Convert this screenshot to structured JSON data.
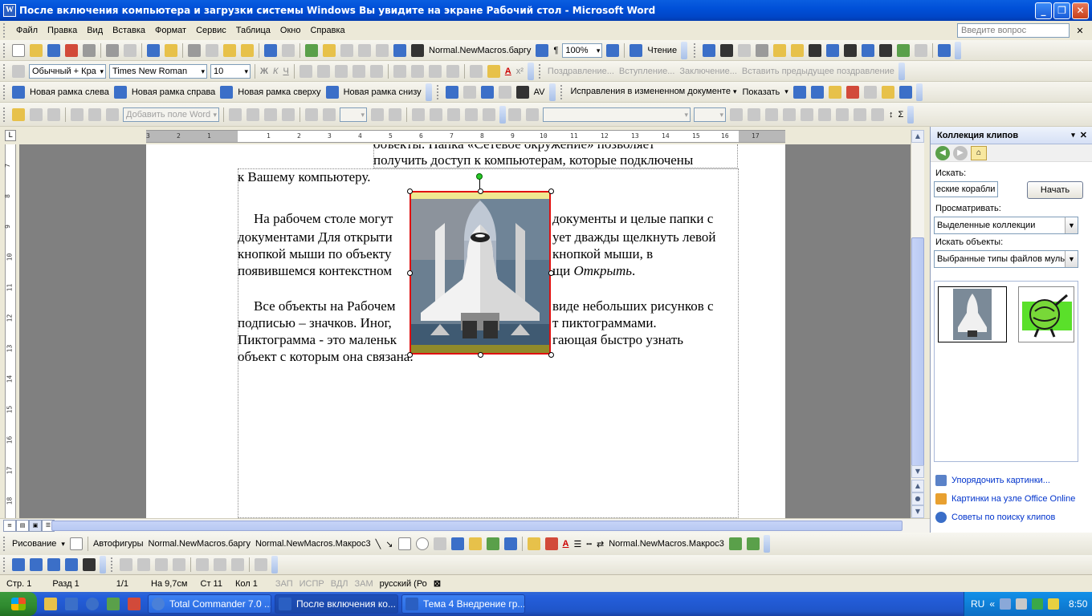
{
  "window": {
    "title": "После включения компьютера и загрузки системы Windows Вы увидите на экране Рабочий стол - Microsoft Word",
    "app_icon": "W"
  },
  "menu": {
    "items": [
      "Файл",
      "Правка",
      "Вид",
      "Вставка",
      "Формат",
      "Сервис",
      "Таблица",
      "Окно",
      "Справка"
    ],
    "help_placeholder": "Введите вопрос"
  },
  "toolbar_standard": {
    "macro_label": "Normal.NewMacros.баргу",
    "zoom": "100%",
    "reading": "Чтение"
  },
  "toolbar_formatting": {
    "style": "Обычный + Кра",
    "font": "Times New Roman",
    "size": "10",
    "mail_items": [
      "Поздравление...",
      "Вступление...",
      "Заключение...",
      "Вставить предыдущее поздравление"
    ]
  },
  "toolbar_frames": {
    "left": "Новая рамка слева",
    "right": "Новая рамка справа",
    "top": "Новая рамка сверху",
    "bottom": "Новая рамка снизу",
    "tracking": "Исправления в измененном документе",
    "show": "Показать"
  },
  "toolbar_mailmerge": {
    "add_field": "Добавить поле Word"
  },
  "ruler": {
    "marks": [
      "3",
      "2",
      "1",
      "1",
      "2",
      "3",
      "4",
      "5",
      "6",
      "7",
      "8",
      "9",
      "10",
      "11",
      "12",
      "13",
      "14",
      "15",
      "16",
      "17"
    ],
    "vmarks": [
      "7",
      "8",
      "9",
      "10",
      "11",
      "12",
      "13",
      "14",
      "15",
      "16",
      "17",
      "18"
    ]
  },
  "document": {
    "top_lines": [
      "объекты. Папка «Сетевое окружение» позволяет",
      "получить доступ к компьютерам, которые подключены"
    ],
    "line1": "к Вашему компьютеру.",
    "p2": [
      "На рабочем столе могут",
      "документы и целые папки с",
      "документами Для открыти",
      "ует дважды щелкнуть левой",
      "кнопкой мыши по объекту",
      "кнопкой мыши, в",
      "появившемся  контекстном",
      "щи ",
      "Открыть",
      "."
    ],
    "p3": [
      "Все объекты на Рабочем",
      "виде небольших рисунков с",
      "подписью – значков. Иног,",
      "т пиктограммами.",
      "Пиктограмма - это маленьк",
      "гающая быстро узнать",
      "объект с которым она связана."
    ]
  },
  "taskpane": {
    "title": "Коллекция клипов",
    "search_label": "Искать:",
    "search_value": "еские корабли",
    "go_button": "Начать",
    "browse_label": "Просматривать:",
    "browse_value": "Выделенные коллекции",
    "objects_label": "Искать объекты:",
    "objects_value": "Выбранные типы файлов муль",
    "links": [
      "Упорядочить картинки...",
      "Картинки на узле Office Online",
      "Советы по поиску клипов"
    ]
  },
  "drawing": {
    "draw": "Рисование",
    "autoshapes": "Автофигуры",
    "macro1": "Normal.NewMacros.баргу",
    "macro2": "Normal.NewMacros.Макрос3",
    "macro3": "Normal.NewMacros.Макрос3"
  },
  "status": {
    "page": "Стр. 1",
    "section": "Разд 1",
    "pages": "1/1",
    "at": "На 9,7см",
    "line": "Ст 11",
    "col": "Кол 1",
    "rec": "ЗАП",
    "trk": "ИСПР",
    "ext": "ВДЛ",
    "ovr": "ЗАМ",
    "lang": "русский (Ро"
  },
  "taskbar": {
    "tasks": [
      "Total Commander 7.0 ...",
      "После включения ко...",
      "Тема 4 Внедрение гр..."
    ],
    "lang": "RU",
    "time": "8:50"
  },
  "colors": {
    "title_blue": "#0050d8",
    "selection_red": "#e01010",
    "taskbar_blue": "#245edb",
    "tray_blue": "#0f80d8"
  }
}
